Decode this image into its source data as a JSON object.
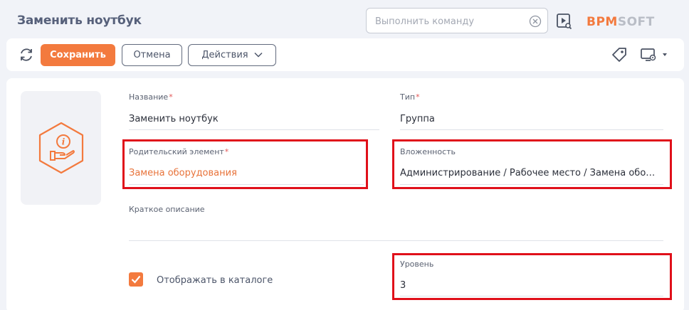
{
  "header": {
    "title": "Заменить ноутбук",
    "command_placeholder": "Выполнить команду",
    "logo_text": "BPMSOFT",
    "logo_icon": "bpmsoft-logo",
    "clear_icon": "clear-icon",
    "video_icon": "video-search-icon"
  },
  "toolbar": {
    "refresh_icon": "refresh-icon",
    "save_label": "Сохранить",
    "cancel_label": "Отмена",
    "actions_label": "Действия",
    "tag_icon": "tag-icon",
    "settings_icon": "monitor-settings-icon"
  },
  "form": {
    "image_icon": "info-hand-hexagon-icon",
    "name": {
      "label": "Название",
      "value": "Заменить ноутбук",
      "required": true
    },
    "type": {
      "label": "Тип",
      "value": "Группа",
      "required": true
    },
    "parent": {
      "label": "Родительский элемент",
      "value": "Замена оборудования",
      "required": true
    },
    "nesting": {
      "label": "Вложенность",
      "value": "Администрирование / Рабочее место / Замена оборудования"
    },
    "description": {
      "label": "Краткое описание",
      "value": ""
    },
    "show_in_catalog": {
      "label": "Отображать в каталоге",
      "checked": true
    },
    "level": {
      "label": "Уровень",
      "value": "3"
    }
  },
  "colors": {
    "accent": "#f37a3e",
    "highlight": "#e0101a",
    "link": "#e8733a",
    "required": "#e35757"
  }
}
